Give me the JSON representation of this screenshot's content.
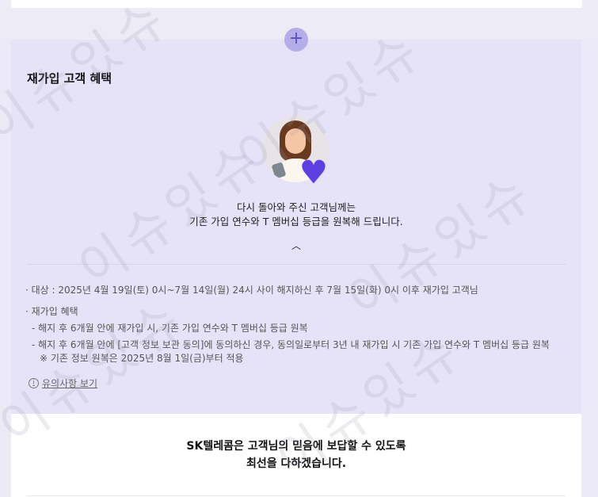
{
  "section": {
    "title": "재가입 고객 혜택",
    "expand_icon": "plus-icon",
    "collapse_icon": "chevron-up-icon",
    "intro_line1": "다시 돌아와 주신 고객님께는",
    "intro_line2": "기존 가입 연수와 T 멤버십 등급을 원복해 드립니다."
  },
  "details": {
    "target": "· 대상 :  2025년 4월 19일(토) 0시~7월 14일(월) 24시 사이 해지하신 후 7월 15일(화) 0시 이후 재가입 고객님",
    "benefit_heading": "· 재가입 혜택",
    "benefit_1": "- 해지 후 6개월 안에 재가입 시, 기존 가입 연수와 T 멤버십 등급 원복",
    "benefit_2": "- 해지 후 6개월 안에 [고객 정보 보관 동의]에 동의하신 경우, 동의일로부터 3년 내 재가입 시 기존 가입 연수와 T 멤버십 등급 원복",
    "note": "※ 기존 정보 원복은 2025년 8월 1일(금)부터 적용"
  },
  "notice_link": "유의사항 보기",
  "closing": {
    "line1": "SK텔레콤은 고객님의 믿음에 보답할 수 있도록",
    "line2": "최선을 다하겠습니다."
  },
  "watermark": "이슈있슈",
  "colors": {
    "panel_bg": "#e6e3f8",
    "accent": "#5c3fe0",
    "plus_bg": "#b5ade8"
  }
}
